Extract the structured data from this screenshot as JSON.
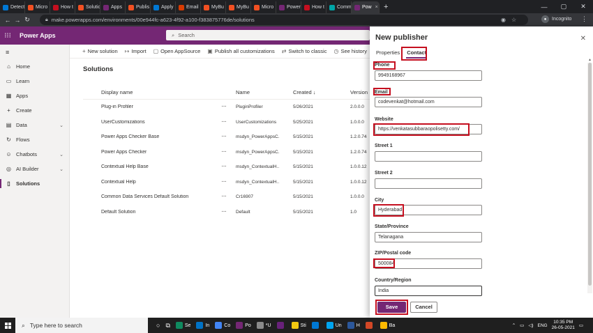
{
  "browser": {
    "tabs": [
      {
        "label": "Detect",
        "color": "#0078d4"
      },
      {
        "label": "Micro",
        "color": "#f25022"
      },
      {
        "label": "How t",
        "color": "#c50f1f"
      },
      {
        "label": "Solutio",
        "color": "#f25022"
      },
      {
        "label": "Apps",
        "color": "#742774"
      },
      {
        "label": "Publis",
        "color": "#f25022"
      },
      {
        "label": "Apply",
        "color": "#0078d4"
      },
      {
        "label": "Email",
        "color": "#d83b01"
      },
      {
        "label": "MyBu",
        "color": "#f25022"
      },
      {
        "label": "MyBu",
        "color": "#f25022"
      },
      {
        "label": "Micro",
        "color": "#f25022"
      },
      {
        "label": "Power",
        "color": "#742774"
      },
      {
        "label": "How t",
        "color": "#c50f1f"
      },
      {
        "label": "Comm",
        "color": "#00a4a6"
      },
      {
        "label": "Pow",
        "color": "#742774",
        "active": true
      }
    ],
    "new_tab": "+",
    "url": "make.powerapps.com/environments/00e944fc-a623-4f92-a100-f383875776de/solutions",
    "profile_label": "Incognito"
  },
  "app": {
    "name": "Power Apps",
    "search_placeholder": "Search",
    "brand_color": "#742774"
  },
  "nav": {
    "items": [
      {
        "label": "Home",
        "icon": "home-icon",
        "glyph": "⌂"
      },
      {
        "label": "Learn",
        "icon": "book-icon",
        "glyph": "▭"
      },
      {
        "label": "Apps",
        "icon": "apps-icon",
        "glyph": "▦"
      },
      {
        "label": "Create",
        "icon": "plus-icon",
        "glyph": "+"
      },
      {
        "label": "Data",
        "icon": "data-icon",
        "glyph": "▤",
        "expand": true
      },
      {
        "label": "Flows",
        "icon": "flow-icon",
        "glyph": "↻"
      },
      {
        "label": "Chatbots",
        "icon": "chatbot-icon",
        "glyph": "☺",
        "expand": true
      },
      {
        "label": "AI Builder",
        "icon": "ai-builder-icon",
        "glyph": "◎",
        "expand": true
      },
      {
        "label": "Solutions",
        "icon": "solutions-icon",
        "glyph": "▯",
        "active": true
      }
    ]
  },
  "commands": [
    {
      "label": "New solution",
      "glyph": "+",
      "icon": "plus-icon"
    },
    {
      "label": "Import",
      "glyph": "↦",
      "icon": "import-icon"
    },
    {
      "label": "Open AppSource",
      "glyph": "▢",
      "icon": "appsource-icon"
    },
    {
      "label": "Publish all customizations",
      "glyph": "▣",
      "icon": "publish-icon"
    },
    {
      "label": "Switch to classic",
      "glyph": "⇄",
      "icon": "switch-icon"
    },
    {
      "label": "See history",
      "glyph": "◷",
      "icon": "history-icon"
    }
  ],
  "page": {
    "title": "Solutions"
  },
  "grid": {
    "headers": {
      "display_name": "Display name",
      "name": "Name",
      "created": "Created ↓",
      "version": "Version"
    },
    "rows": [
      {
        "display": "Plug-in Profiler",
        "name": "PluginProfiler",
        "created": "5/26/2021",
        "version": "2.0.0.0"
      },
      {
        "display": "UserCustomizations",
        "name": "UserCustomizations",
        "created": "5/25/2021",
        "version": "1.0.0.0"
      },
      {
        "display": "Power Apps Checker Base",
        "name": "msdyn_PowerAppsC...",
        "created": "5/15/2021",
        "version": "1.2.0.74"
      },
      {
        "display": "Power Apps Checker",
        "name": "msdyn_PowerAppsC...",
        "created": "5/15/2021",
        "version": "1.2.0.74"
      },
      {
        "display": "Contextual Help Base",
        "name": "msdyn_ContextualH...",
        "created": "5/15/2021",
        "version": "1.0.0.12"
      },
      {
        "display": "Contextual Help",
        "name": "msdyn_ContextualH...",
        "created": "5/15/2021",
        "version": "1.0.0.12"
      },
      {
        "display": "Common Data Services Default Solution",
        "name": "Cr16907",
        "created": "5/15/2021",
        "version": "1.0.0.0"
      },
      {
        "display": "Default Solution",
        "name": "Default",
        "created": "5/15/2021",
        "version": "1.0"
      }
    ]
  },
  "panel": {
    "title": "New publisher",
    "tabs": {
      "properties": "Properties",
      "contact": "Contact"
    },
    "fields": {
      "phone": {
        "label": "Phone",
        "value": "9949168967"
      },
      "email": {
        "label": "Email",
        "value": "codevenkat@hotmail.com"
      },
      "website": {
        "label": "Website",
        "value": "https://venkatasubbaraopolisetty.com/"
      },
      "street1": {
        "label": "Street 1",
        "value": ""
      },
      "street2": {
        "label": "Street 2",
        "value": ""
      },
      "city": {
        "label": "City",
        "value": "Hyderabad"
      },
      "state": {
        "label": "State/Province",
        "value": "Telanagana"
      },
      "zip": {
        "label": "ZIP/Postal code",
        "value": "500084"
      },
      "country": {
        "label": "Country/Region",
        "value": "India"
      }
    },
    "save_label": "Save",
    "cancel_label": "Cancel",
    "highlight_color": "#c50f1f"
  },
  "taskbar": {
    "search_placeholder": "Type here to search",
    "apps": [
      {
        "label": "Se",
        "color": "#0f8a5f"
      },
      {
        "label": "In",
        "color": "#0072c6"
      },
      {
        "label": "Co",
        "color": "#4285f4"
      },
      {
        "label": "Po",
        "color": "#742774"
      },
      {
        "label": "*U",
        "color": "#8a8a8a"
      },
      {
        "label": "",
        "color": "#68217a"
      },
      {
        "label": "Sti",
        "color": "#f2c811"
      },
      {
        "label": "",
        "color": "#0078d4"
      },
      {
        "label": "Un",
        "color": "#00a4ef"
      },
      {
        "label": "H",
        "color": "#2b579a"
      },
      {
        "label": "",
        "color": "#d24726"
      },
      {
        "label": "Ba",
        "color": "#ffb900"
      }
    ],
    "tray_lang": "ENG",
    "time": "10:35 PM",
    "date": "26-05-2021"
  }
}
